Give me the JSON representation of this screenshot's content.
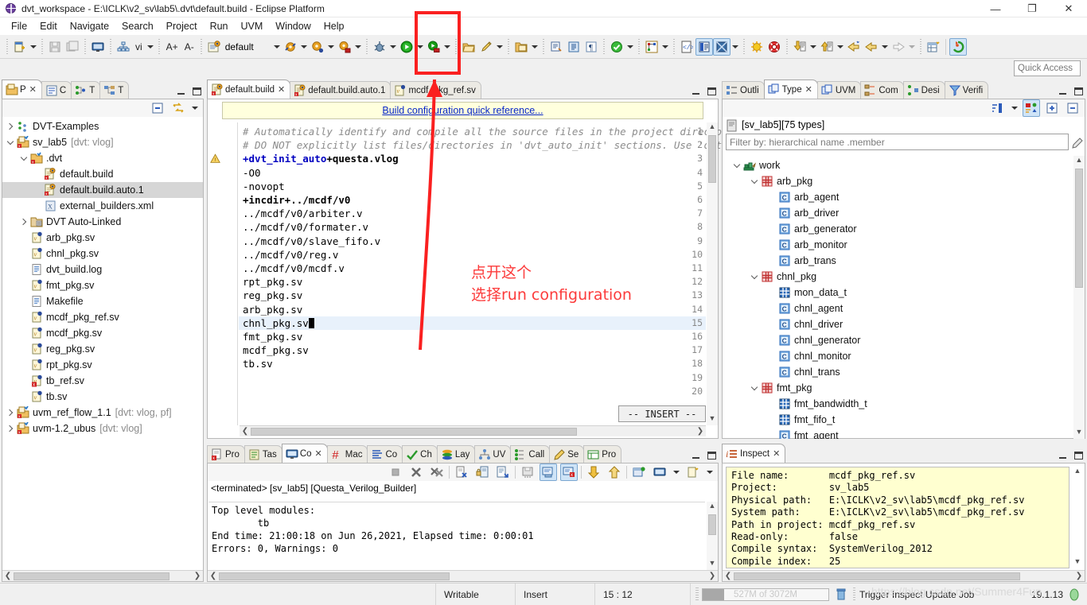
{
  "window": {
    "title": "dvt_workspace - E:\\ICLK\\v2_sv\\lab5\\.dvt\\default.build - Eclipse Platform",
    "minimize": "—",
    "maximize": "❐",
    "close": "✕"
  },
  "menubar": {
    "items": [
      "File",
      "Edit",
      "Navigate",
      "Search",
      "Project",
      "Run",
      "UVM",
      "Window",
      "Help"
    ]
  },
  "toolbar": {
    "vi_label": "vi",
    "font_increase": "A+",
    "font_decrease": "A-",
    "build_config": "default",
    "quick_access": "Quick Access"
  },
  "project_explorer": {
    "tabs": [
      {
        "label": "P",
        "icon": "project-explorer-icon",
        "active": true,
        "closable": true
      },
      {
        "label": "C",
        "icon": "compile-order-icon",
        "active": false,
        "closable": false
      },
      {
        "label": "T",
        "icon": "types-icon",
        "active": false,
        "closable": false
      },
      {
        "label": "T",
        "icon": "hierarchy-icon",
        "active": false,
        "closable": false
      }
    ],
    "tree": [
      {
        "label": "DVT-Examples",
        "decor": "",
        "indent": 0,
        "twist": "right",
        "icon": "examples-icon",
        "selected": false
      },
      {
        "label": "sv_lab5",
        "decor": "[dvt: vlog]",
        "indent": 0,
        "twist": "down",
        "icon": "project-icon",
        "selected": false
      },
      {
        "label": ".dvt",
        "decor": "",
        "indent": 1,
        "twist": "down",
        "icon": "folder-icon",
        "selected": false
      },
      {
        "label": "default.build",
        "decor": "",
        "indent": 2,
        "twist": "none",
        "icon": "build-file-icon",
        "selected": false
      },
      {
        "label": "default.build.auto.1",
        "decor": "",
        "indent": 2,
        "twist": "none",
        "icon": "build-file-icon",
        "selected": true
      },
      {
        "label": "external_builders.xml",
        "decor": "",
        "indent": 2,
        "twist": "none",
        "icon": "xml-file-icon",
        "selected": false
      },
      {
        "label": "DVT Auto-Linked",
        "decor": "",
        "indent": 1,
        "twist": "right",
        "icon": "linked-folder-icon",
        "selected": false
      },
      {
        "label": "arb_pkg.sv",
        "decor": "",
        "indent": 1,
        "twist": "none",
        "icon": "verilog-file-icon",
        "selected": false
      },
      {
        "label": "chnl_pkg.sv",
        "decor": "",
        "indent": 1,
        "twist": "none",
        "icon": "verilog-file-icon",
        "selected": false
      },
      {
        "label": "dvt_build.log",
        "decor": "",
        "indent": 1,
        "twist": "none",
        "icon": "log-file-icon",
        "selected": false
      },
      {
        "label": "fmt_pkg.sv",
        "decor": "",
        "indent": 1,
        "twist": "none",
        "icon": "verilog-file-icon",
        "selected": false
      },
      {
        "label": "Makefile",
        "decor": "",
        "indent": 1,
        "twist": "none",
        "icon": "log-file-icon",
        "selected": false
      },
      {
        "label": "mcdf_pkg_ref.sv",
        "decor": "",
        "indent": 1,
        "twist": "none",
        "icon": "verilog-file-icon",
        "selected": false
      },
      {
        "label": "mcdf_pkg.sv",
        "decor": "",
        "indent": 1,
        "twist": "none",
        "icon": "verilog-file-icon",
        "selected": false
      },
      {
        "label": "reg_pkg.sv",
        "decor": "",
        "indent": 1,
        "twist": "none",
        "icon": "verilog-file-icon",
        "selected": false
      },
      {
        "label": "rpt_pkg.sv",
        "decor": "",
        "indent": 1,
        "twist": "none",
        "icon": "verilog-file-icon",
        "selected": false
      },
      {
        "label": "tb_ref.sv",
        "decor": "",
        "indent": 1,
        "twist": "none",
        "icon": "verilog-error-file-icon",
        "selected": false
      },
      {
        "label": "tb.sv",
        "decor": "",
        "indent": 1,
        "twist": "none",
        "icon": "verilog-file-icon",
        "selected": false
      },
      {
        "label": "uvm_ref_flow_1.1",
        "decor": "[dvt: vlog, pf]",
        "indent": 0,
        "twist": "right",
        "icon": "project-icon",
        "selected": false
      },
      {
        "label": "uvm-1.2_ubus",
        "decor": "[dvt: vlog]",
        "indent": 0,
        "twist": "right",
        "icon": "project-icon",
        "selected": false
      }
    ]
  },
  "editor": {
    "tabs": [
      {
        "label": "default.build",
        "icon": "build-file-icon",
        "active": true,
        "closable": true
      },
      {
        "label": "default.build.auto.1",
        "icon": "build-file-icon",
        "active": false,
        "closable": false
      },
      {
        "label": "mcdf_pkg_ref.sv",
        "icon": "verilog-file-icon",
        "active": false,
        "closable": false
      }
    ],
    "hint_link": "Build configuration quick reference...",
    "lines": [
      {
        "n": 1,
        "text": "# Automatically identify and compile all the source files in the project director",
        "style": "comment",
        "marker": ""
      },
      {
        "n": 2,
        "text": "# DO NOT explicitly list files/directories in 'dvt_auto_init' sections. Use 'dvt_",
        "style": "comment",
        "marker": ""
      },
      {
        "n": 3,
        "text": "+dvt_init_auto+questa.vlog",
        "style": "keyword",
        "marker": "warning"
      },
      {
        "n": 4,
        "text": "-O0",
        "style": "plain",
        "marker": ""
      },
      {
        "n": 5,
        "text": "-novopt",
        "style": "plain",
        "marker": ""
      },
      {
        "n": 6,
        "text": "+incdir+../mcdf/v0",
        "style": "bold",
        "marker": ""
      },
      {
        "n": 7,
        "text": "../mcdf/v0/arbiter.v",
        "style": "plain",
        "marker": ""
      },
      {
        "n": 8,
        "text": "../mcdf/v0/formater.v",
        "style": "plain",
        "marker": ""
      },
      {
        "n": 9,
        "text": "../mcdf/v0/slave_fifo.v",
        "style": "plain",
        "marker": ""
      },
      {
        "n": 10,
        "text": "../mcdf/v0/reg.v",
        "style": "plain",
        "marker": ""
      },
      {
        "n": 11,
        "text": "../mcdf/v0/mcdf.v",
        "style": "plain",
        "marker": ""
      },
      {
        "n": 12,
        "text": "rpt_pkg.sv",
        "style": "plain",
        "marker": ""
      },
      {
        "n": 13,
        "text": "reg_pkg.sv",
        "style": "plain",
        "marker": ""
      },
      {
        "n": 14,
        "text": "arb_pkg.sv",
        "style": "plain",
        "marker": ""
      },
      {
        "n": 15,
        "text": "chnl_pkg.sv",
        "style": "plain",
        "marker": "",
        "current": true
      },
      {
        "n": 16,
        "text": "fmt_pkg.sv",
        "style": "plain",
        "marker": ""
      },
      {
        "n": 17,
        "text": "mcdf_pkg.sv",
        "style": "plain",
        "marker": ""
      },
      {
        "n": 18,
        "text": "tb.sv",
        "style": "plain",
        "marker": ""
      },
      {
        "n": 19,
        "text": "",
        "style": "plain",
        "marker": ""
      },
      {
        "n": 20,
        "text": "",
        "style": "plain",
        "marker": ""
      }
    ],
    "vim_mode": "-- INSERT --"
  },
  "types_view": {
    "tabs": [
      {
        "label": "Outli",
        "icon": "outline-icon",
        "active": false,
        "closable": false
      },
      {
        "label": "Type",
        "icon": "types-icon",
        "active": true,
        "closable": true
      },
      {
        "label": "UVM",
        "icon": "uvm-icon",
        "active": false,
        "closable": false
      },
      {
        "label": "Com",
        "icon": "components-icon",
        "active": false,
        "closable": false
      },
      {
        "label": "Desi",
        "icon": "design-icon",
        "active": false,
        "closable": false
      },
      {
        "label": "Verifi",
        "icon": "verification-icon",
        "active": false,
        "closable": false
      }
    ],
    "scope": "[sv_lab5][75 types]",
    "filter_placeholder": "Filter by: hierarchical name .member",
    "tree": [
      {
        "label": "work",
        "indent": 0,
        "twist": "down",
        "icon": "library-icon"
      },
      {
        "label": "arb_pkg",
        "indent": 1,
        "twist": "down",
        "icon": "package-icon"
      },
      {
        "label": "arb_agent",
        "indent": 2,
        "twist": "none",
        "icon": "class-icon"
      },
      {
        "label": "arb_driver",
        "indent": 2,
        "twist": "none",
        "icon": "class-icon"
      },
      {
        "label": "arb_generator",
        "indent": 2,
        "twist": "none",
        "icon": "class-icon"
      },
      {
        "label": "arb_monitor",
        "indent": 2,
        "twist": "none",
        "icon": "class-icon"
      },
      {
        "label": "arb_trans",
        "indent": 2,
        "twist": "none",
        "icon": "class-icon"
      },
      {
        "label": "chnl_pkg",
        "indent": 1,
        "twist": "down",
        "icon": "package-icon"
      },
      {
        "label": "mon_data_t",
        "indent": 2,
        "twist": "none",
        "icon": "struct-icon"
      },
      {
        "label": "chnl_agent",
        "indent": 2,
        "twist": "none",
        "icon": "class-icon"
      },
      {
        "label": "chnl_driver",
        "indent": 2,
        "twist": "none",
        "icon": "class-icon"
      },
      {
        "label": "chnl_generator",
        "indent": 2,
        "twist": "none",
        "icon": "class-icon"
      },
      {
        "label": "chnl_monitor",
        "indent": 2,
        "twist": "none",
        "icon": "class-icon"
      },
      {
        "label": "chnl_trans",
        "indent": 2,
        "twist": "none",
        "icon": "class-icon"
      },
      {
        "label": "fmt_pkg",
        "indent": 1,
        "twist": "down",
        "icon": "package-icon"
      },
      {
        "label": "fmt_bandwidth_t",
        "indent": 2,
        "twist": "none",
        "icon": "struct-icon"
      },
      {
        "label": "fmt_fifo_t",
        "indent": 2,
        "twist": "none",
        "icon": "struct-icon"
      },
      {
        "label": "fmt_agent",
        "indent": 2,
        "twist": "none",
        "icon": "class-icon"
      }
    ]
  },
  "console_view": {
    "tabs": [
      {
        "label": "Pro",
        "icon": "problems-icon",
        "active": false,
        "closable": false
      },
      {
        "label": "Tas",
        "icon": "tasks-icon",
        "active": false,
        "closable": false
      },
      {
        "label": "Co",
        "icon": "console-icon",
        "active": true,
        "closable": true
      },
      {
        "label": "Mac",
        "icon": "macros-icon",
        "active": false,
        "closable": false
      },
      {
        "label": "Co",
        "icon": "compile-order-icon",
        "active": false,
        "closable": false
      },
      {
        "label": "Ch",
        "icon": "checks-icon",
        "active": false,
        "closable": false
      },
      {
        "label": "Lay",
        "icon": "layers-icon",
        "active": false,
        "closable": false
      },
      {
        "label": "UV",
        "icon": "uvm-hierarchy-icon",
        "active": false,
        "closable": false
      },
      {
        "label": "Call",
        "icon": "call-hierarchy-icon",
        "active": false,
        "closable": false
      },
      {
        "label": "Se",
        "icon": "search-icon",
        "active": false,
        "closable": false
      },
      {
        "label": "Pro",
        "icon": "properties-icon",
        "active": false,
        "closable": false
      }
    ],
    "header": "<terminated> [sv_lab5] [Questa_Verilog_Builder]",
    "output": "Top level modules:\n        tb\nEnd time: 21:00:18 on Jun 26,2021, Elapsed time: 0:00:01\nErrors: 0, Warnings: 0"
  },
  "inspect_view": {
    "tab_label": "Inspect",
    "rows": [
      {
        "key": "File name:",
        "value": "mcdf_pkg_ref.sv"
      },
      {
        "key": "Project:",
        "value": "sv_lab5"
      },
      {
        "key": "Physical path:",
        "value": "E:\\ICLK\\v2_sv\\lab5\\mcdf_pkg_ref.sv"
      },
      {
        "key": "System path:",
        "value": "E:\\ICLK\\v2_sv\\lab5\\mcdf_pkg_ref.sv"
      },
      {
        "key": "Path in project:",
        "value": "mcdf_pkg_ref.sv"
      },
      {
        "key": "Read-only:",
        "value": "false"
      },
      {
        "key": "Compile syntax:",
        "value": "SystemVerilog_2012"
      },
      {
        "key": "Compile index:",
        "value": "25"
      }
    ]
  },
  "statusbar": {
    "writable": "Writable",
    "insert_mode": "Insert",
    "cursor_position": "15 : 12",
    "heap_text": "527M of 3072M",
    "heap_percent": 17,
    "job_text": "Trigger Inspect Update Job",
    "version": "19.1.13"
  },
  "annotations": {
    "line1": "点开这个",
    "line2": "选择run configuration",
    "watermark": "https://blog.csdn.net/Summer4Fun"
  },
  "colors": {
    "annotation_red": "#fc3b3b",
    "rect_red": "#fa2020",
    "link_blue": "#0a28c8",
    "keyword_blue": "#0000c0",
    "hint_bg": "#ffffdd",
    "inspect_bg": "#ffffd0",
    "selection_gray": "#d6d6d6",
    "current_line": "#e8f1fb"
  }
}
